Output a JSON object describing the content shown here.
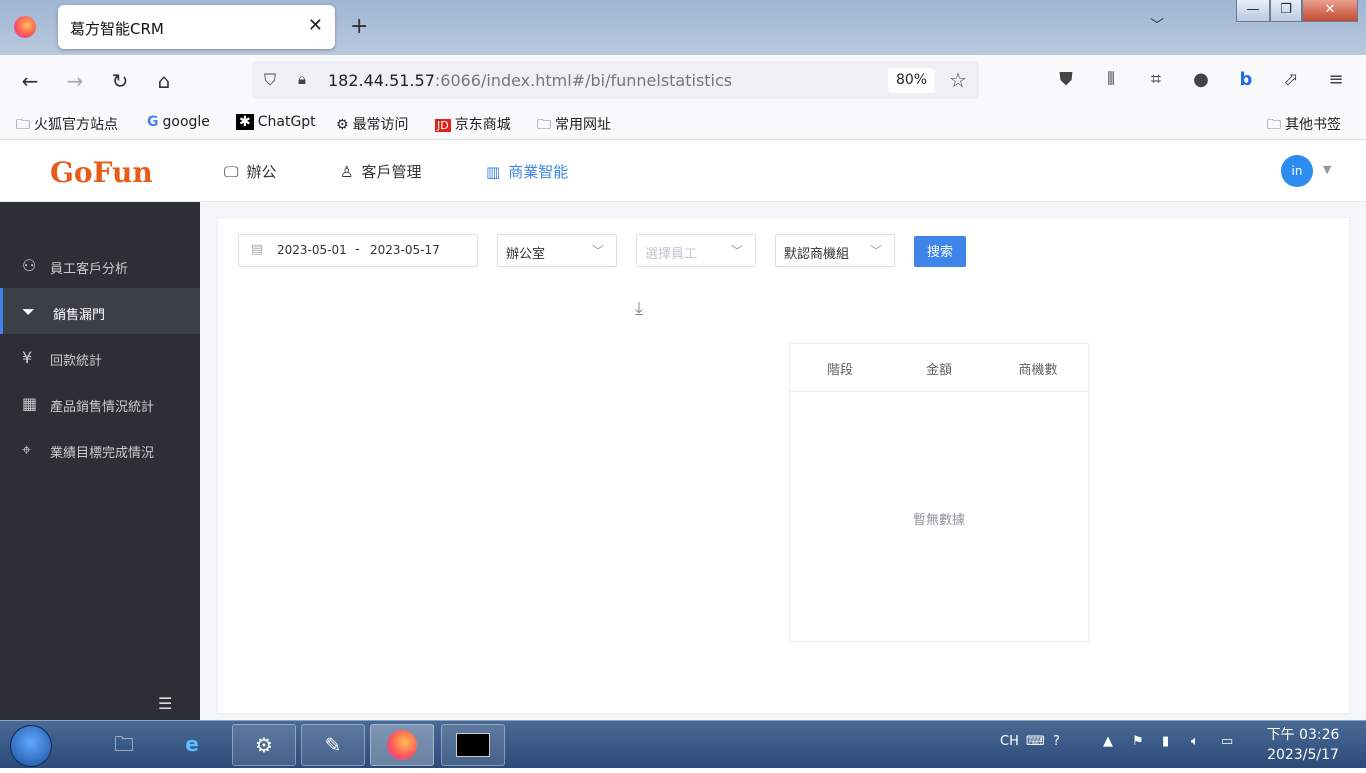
{
  "browser": {
    "tab_title": "葛方智能CRM",
    "tab_close": "✕",
    "new_tab": "+",
    "url_host": "182.44.51.57",
    "url_rest": ":6066/index.html#/bi/funnelstatistics",
    "zoom": "80%",
    "bookmarks": [
      {
        "label": "火狐官方站点",
        "icon": "folder-icon"
      },
      {
        "label": "google",
        "icon": "google-icon"
      },
      {
        "label": "ChatGpt",
        "icon": "chatgpt-icon"
      },
      {
        "label": "最常访问",
        "icon": "gear-icon"
      },
      {
        "label": "京东商城",
        "icon": "jd-icon"
      },
      {
        "label": "常用网址",
        "icon": "folder-icon"
      }
    ],
    "other_bookmarks": "其他书签"
  },
  "app": {
    "logo": "GoFun",
    "nav": [
      {
        "label": "辦公",
        "icon": "monitor-icon"
      },
      {
        "label": "客戶管理",
        "icon": "user-icon"
      },
      {
        "label": "商業智能",
        "icon": "bar-chart-icon",
        "active": true
      }
    ],
    "avatar": "in"
  },
  "sidebar": {
    "items": [
      {
        "label": "員工客戶分析",
        "icon": "user-search-icon"
      },
      {
        "label": "銷售漏門",
        "icon": "funnel-icon",
        "active": true
      },
      {
        "label": "回款統計",
        "icon": "yen-icon"
      },
      {
        "label": "產品銷售情況統計",
        "icon": "grid-icon"
      },
      {
        "label": "業績目標完成情況",
        "icon": "target-icon"
      }
    ]
  },
  "filters": {
    "date_start": "2023-05-01",
    "date_sep": "-",
    "date_end": "2023-05-17",
    "department": "辦公室",
    "employee_placeholder": "選擇員工",
    "group": "默認商機組",
    "search_label": "搜索"
  },
  "table": {
    "headers": [
      "階段",
      "金額",
      "商機數"
    ],
    "empty_text": "暫無數據"
  },
  "taskbar": {
    "lang": "CH",
    "time": "下午 03:26",
    "date": "2023/5/17"
  }
}
